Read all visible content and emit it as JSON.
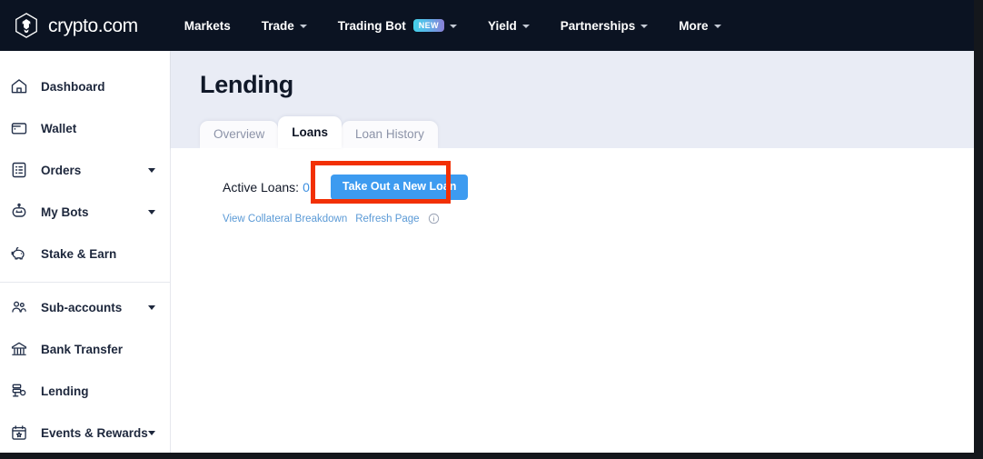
{
  "brand": {
    "name": "crypto.com",
    "logo_icon": "crypto-com-logo-icon"
  },
  "topnav": {
    "items": [
      {
        "label": "Markets",
        "has_caret": false,
        "badge": null
      },
      {
        "label": "Trade",
        "has_caret": true,
        "badge": null
      },
      {
        "label": "Trading Bot",
        "has_caret": true,
        "badge": "NEW"
      },
      {
        "label": "Yield",
        "has_caret": true,
        "badge": null
      },
      {
        "label": "Partnerships",
        "has_caret": true,
        "badge": null
      },
      {
        "label": "More",
        "has_caret": true,
        "badge": null
      }
    ]
  },
  "sidebar": {
    "group_one": [
      {
        "label": "Dashboard",
        "icon": "home-icon",
        "has_caret": false
      },
      {
        "label": "Wallet",
        "icon": "wallet-icon",
        "has_caret": false
      },
      {
        "label": "Orders",
        "icon": "orders-list-icon",
        "has_caret": true
      },
      {
        "label": "My Bots",
        "icon": "robot-icon",
        "has_caret": true
      },
      {
        "label": "Stake & Earn",
        "icon": "piggy-bank-icon",
        "has_caret": false
      }
    ],
    "group_two": [
      {
        "label": "Sub-accounts",
        "icon": "users-icon",
        "has_caret": true
      },
      {
        "label": "Bank Transfer",
        "icon": "bank-icon",
        "has_caret": false
      },
      {
        "label": "Lending",
        "icon": "lending-icon",
        "has_caret": false
      },
      {
        "label": "Events & Rewards",
        "icon": "calendar-star-icon",
        "has_caret": true
      }
    ]
  },
  "main": {
    "title": "Lending",
    "tabs": [
      {
        "label": "Overview",
        "active": false
      },
      {
        "label": "Loans",
        "active": true
      },
      {
        "label": "Loan History",
        "active": false
      }
    ],
    "panel": {
      "active_loans_label": "Active Loans:",
      "active_loans_count": "0",
      "take_loan_button": "Take Out a New Loan",
      "view_collateral_link": "View Collateral Breakdown",
      "refresh_page_link": "Refresh Page",
      "info_icon": "info-circle-icon"
    }
  },
  "colors": {
    "header_bg": "#0b1322",
    "page_bg": "#e9ecf5",
    "accent_blue": "#3d9bf0",
    "link_blue": "#5b9ad6",
    "annotation_red": "#f23005",
    "text_dark": "#101828",
    "text_muted": "#8c93a8"
  }
}
